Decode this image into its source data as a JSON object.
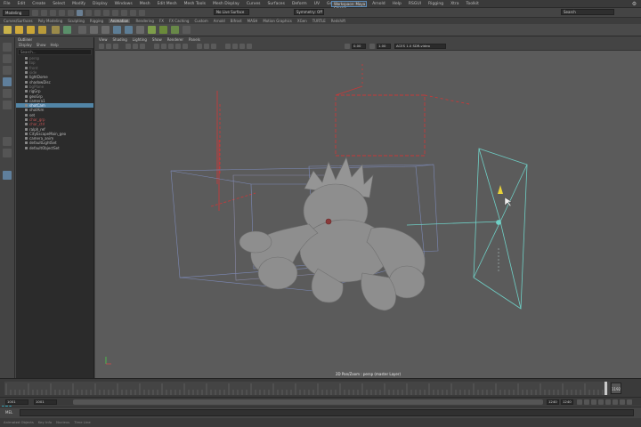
{
  "menubar": {
    "items": [
      "File",
      "Edit",
      "Create",
      "Select",
      "Modify",
      "Display",
      "Windows",
      "Mesh",
      "Edit Mesh",
      "Mesh Tools",
      "Mesh Display",
      "Curves",
      "Surfaces",
      "Deform",
      "UV",
      "Generate",
      "Cache",
      "Arnold",
      "Help",
      "RSGUI",
      "Rigging",
      "Xtra",
      "Toolkit"
    ],
    "workspace": "Workspace: Maya Classic"
  },
  "statusline": {
    "mode": "Modeling",
    "renderer": "No Live Surface",
    "lighting": "Symmetry: Off",
    "search": "Search"
  },
  "shelf": {
    "tabs": [
      "Curves/Surfaces",
      "Poly Modeling",
      "Sculpting",
      "Rigging",
      "Animation",
      "Rendering",
      "FX",
      "FX Caching",
      "Custom",
      "Arnold",
      "Bifrost",
      "MASH",
      "Motion Graphics",
      "XGen",
      "TURTLE",
      "Redshift"
    ],
    "active_tab": "Animation"
  },
  "outliner": {
    "title": "Outliner",
    "menu": [
      "Display",
      "Show",
      "Help"
    ],
    "search_placeholder": "Search...",
    "items": [
      {
        "label": "persp",
        "state": "dim"
      },
      {
        "label": "top",
        "state": "dim"
      },
      {
        "label": "front",
        "state": "dim"
      },
      {
        "label": "side",
        "state": "dim"
      },
      {
        "label": "lightDome",
        "state": "normal"
      },
      {
        "label": "shadowDisc",
        "state": "normal"
      },
      {
        "label": "bgPlane",
        "state": "dim"
      },
      {
        "label": "rigGrp",
        "state": "normal"
      },
      {
        "label": "geoGrp",
        "state": "normal"
      },
      {
        "label": "camera1",
        "state": "normal"
      },
      {
        "label": "shotCam",
        "state": "selected"
      },
      {
        "label": "shotAim",
        "state": "normal"
      },
      {
        "label": "set",
        "state": "normal"
      },
      {
        "label": "char_grp",
        "state": "red"
      },
      {
        "label": "char_ctrl",
        "state": "red"
      },
      {
        "label": "ralph_ref",
        "state": "normal"
      },
      {
        "label": "CityEscapeMain_geo",
        "state": "normal"
      },
      {
        "label": "camera_anim",
        "state": "normal"
      },
      {
        "label": "defaultLightSet",
        "state": "normal"
      },
      {
        "label": "defaultObjectSet",
        "state": "normal"
      }
    ]
  },
  "viewport": {
    "menu": [
      "View",
      "Shading",
      "Lighting",
      "Show",
      "Renderer",
      "Panels"
    ],
    "field_a": "0.00",
    "field_b": "1.00",
    "color_space": "ACES 1.0 SDR-video",
    "camera_label": "2D Pan/Zoom : persp (master Layer)"
  },
  "timeline": {
    "current_frame": "1192"
  },
  "range": {
    "start": "1001",
    "inner_start": "1001",
    "inner_end": "1240",
    "end": "1240"
  },
  "cmdline": {
    "label": "MEL"
  },
  "helpline": {
    "items": [
      "Animated Objects",
      "Key Info",
      "Nucleus",
      "Time Line"
    ]
  },
  "colors": {
    "viewport_bg": "#5b5b5b",
    "selection": "#5285a6",
    "bbox_red": "#c43a3a",
    "camera_cyan": "#6fd0c6",
    "maya_logo": "#3fb3c8"
  },
  "icons": [
    "select-tool-icon",
    "lasso-tool-icon",
    "paint-tool-icon",
    "move-tool-icon",
    "rotate-tool-icon",
    "scale-tool-icon",
    "maya-logo-icon"
  ]
}
